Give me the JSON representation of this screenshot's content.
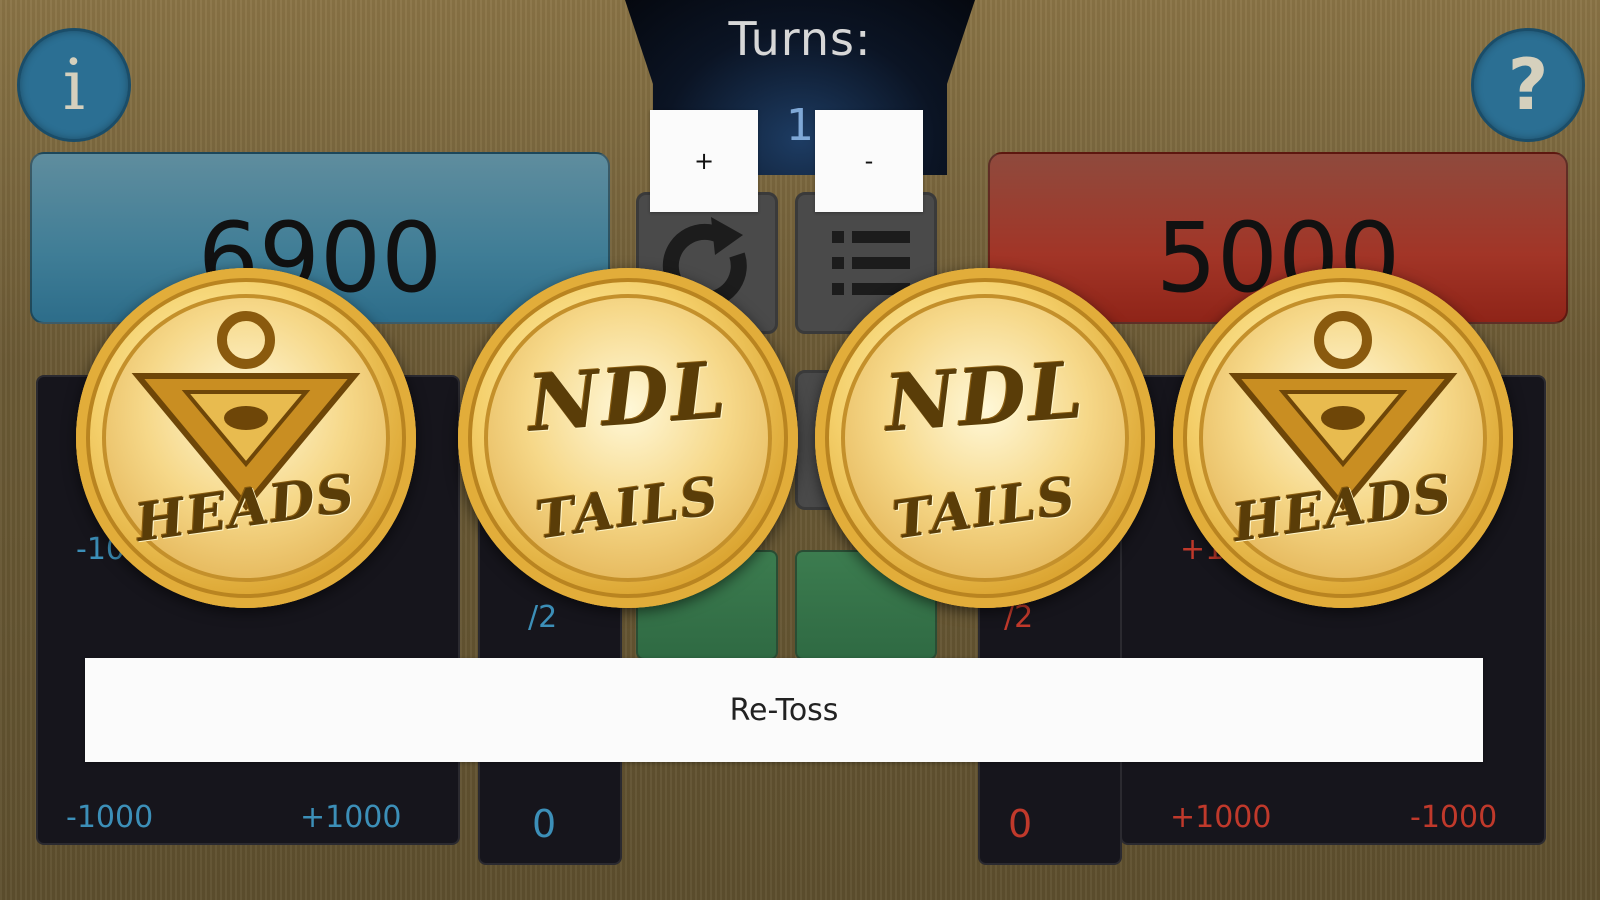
{
  "turns": {
    "label": "Turns:",
    "value": "1",
    "plus_label": "+",
    "minus_label": "-"
  },
  "buttons": {
    "info_label": "i",
    "help_label": "?",
    "retoss_label": "Re-Toss"
  },
  "player_left": {
    "life_points": "6900",
    "color": "#3f7d96",
    "mod_minus_partial": "-10",
    "half_label": "/2",
    "minus_1000": "-1000",
    "plus_1000": "+1000",
    "counter": "0"
  },
  "player_right": {
    "life_points": "5000",
    "color": "#a23527",
    "mod_plus_partial": "+1",
    "half_label": "/2",
    "plus_1000": "+1000",
    "minus_1000": "-1000",
    "counter": "0"
  },
  "coins": [
    {
      "face": "HEADS"
    },
    {
      "face": "TAILS",
      "brand": "NDL"
    },
    {
      "face": "TAILS",
      "brand": "NDL"
    },
    {
      "face": "HEADS"
    }
  ]
}
